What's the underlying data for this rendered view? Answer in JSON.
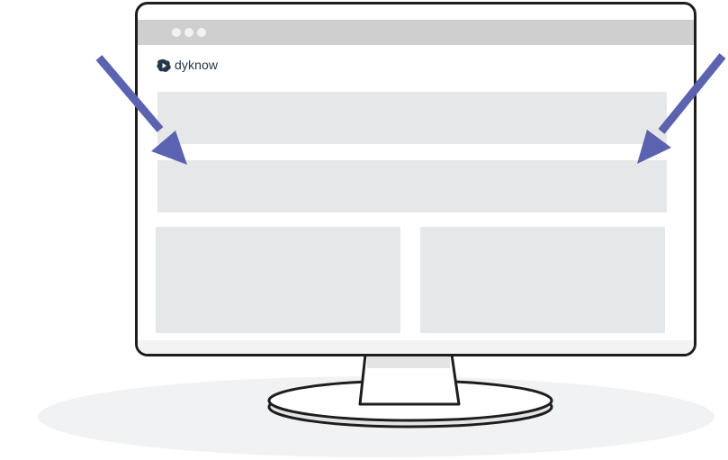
{
  "brand": {
    "name": "dyknow",
    "text_color": "#23384a"
  },
  "icons": {
    "logo": "dyknow-logo-mark",
    "window_controls": "window-control-dots",
    "arrows": "pointing-arrow"
  },
  "colors": {
    "arrow": "#5b63b0",
    "placeholder_block": "#e6e7e8",
    "tab_bar": "#cfcfcf",
    "monitor_outline": "#1d1d1f"
  }
}
